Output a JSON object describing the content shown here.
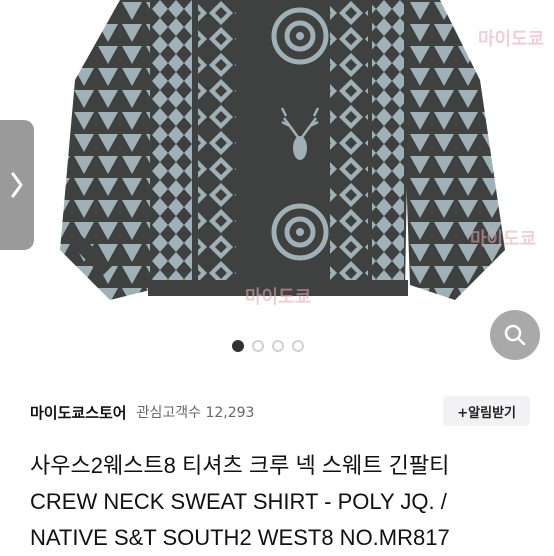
{
  "gallery": {
    "watermark_text": "마이도쿄",
    "total_images": 4,
    "active_index": 0
  },
  "store": {
    "name": "마이도쿄스토어",
    "followers": "관심고객수 12,293",
    "alarm_label": "+알림받기"
  },
  "product": {
    "title_lines": [
      "사우스2웨스트8 티셔츠 크루 넥 스웨트 긴팔티",
      "CREW NECK SWEAT SHIRT - POLY JQ. /",
      "NATIVE S&T SOUTH2 WEST8 NO.MR817"
    ]
  },
  "colors": {
    "sweater": "#3f4140",
    "pattern": "#9fb0b6"
  },
  "icons": {
    "prev": "chevron-right-icon",
    "zoom": "search-icon",
    "alarm": "bell-plus-icon"
  }
}
